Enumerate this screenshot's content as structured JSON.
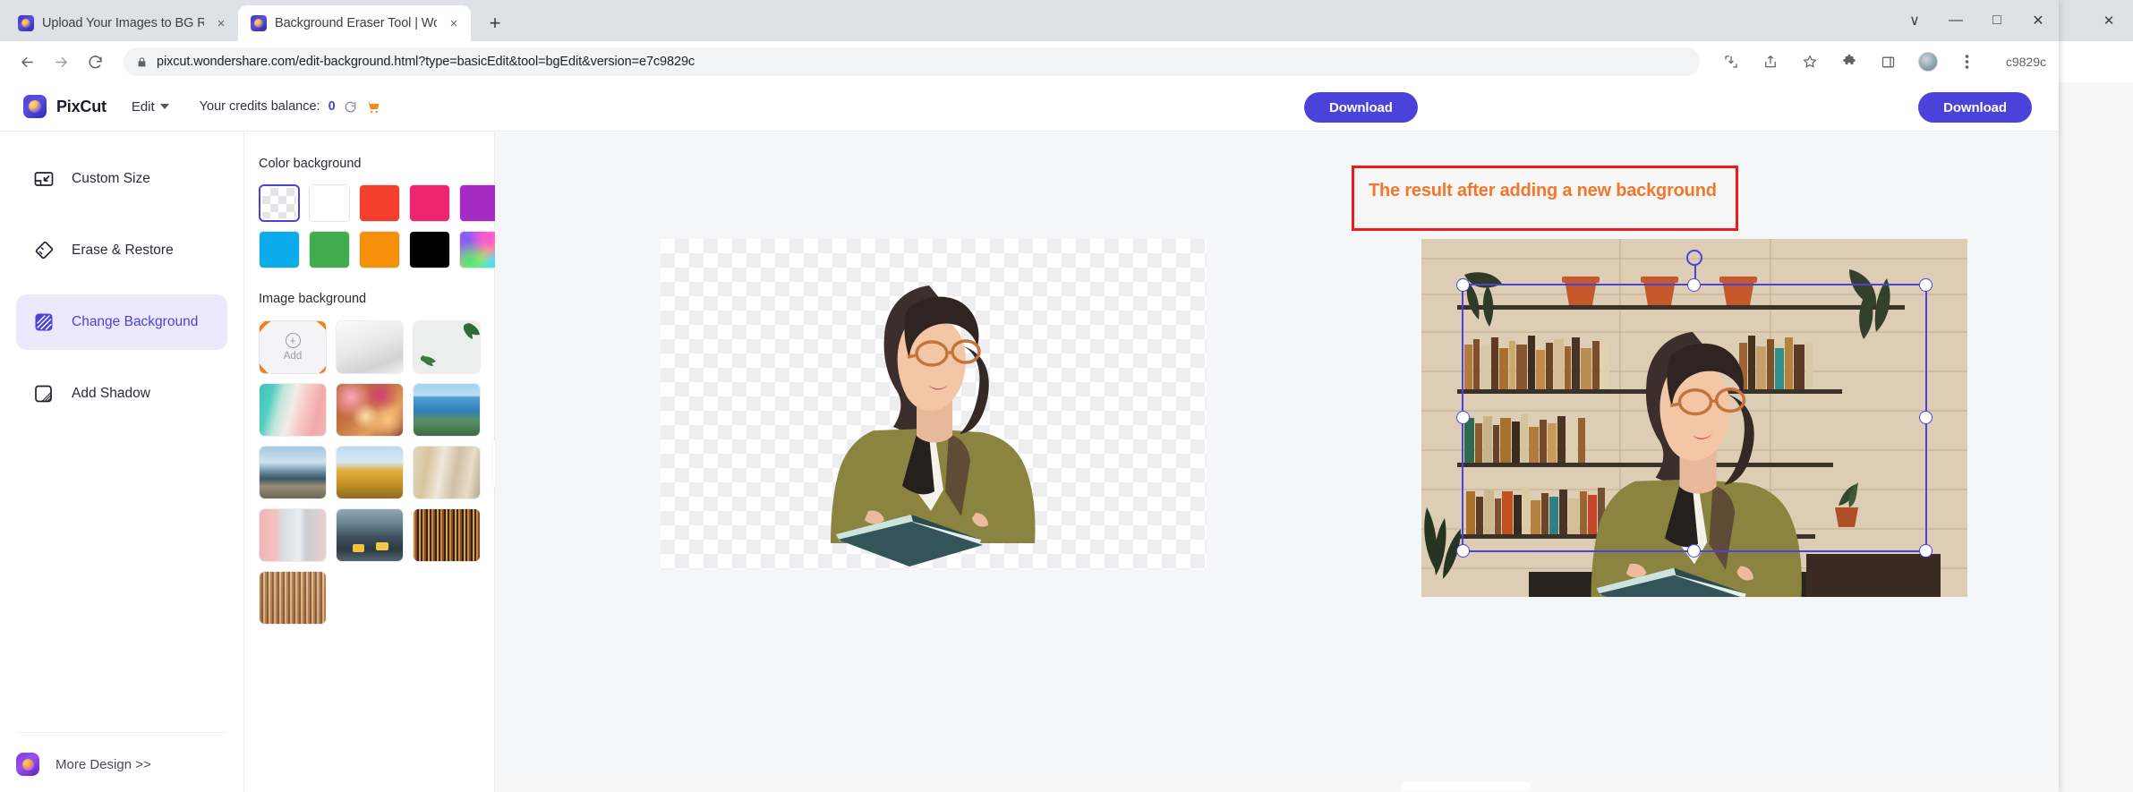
{
  "browser": {
    "tabs": [
      {
        "title": "Upload Your Images to BG Rem",
        "active": false,
        "favicon": "pixcut-favicon",
        "close": "×"
      },
      {
        "title": "Background Eraser Tool | Wonde",
        "active": true,
        "favicon": "pixcut-favicon",
        "close": "×"
      }
    ],
    "new_tab_label": "+",
    "window_controls": {
      "dropdown": "∨",
      "minimize": "—",
      "maximize": "□",
      "close": "✕"
    },
    "nav": {
      "back": "←",
      "forward": "→",
      "reload": "⟳"
    },
    "url": "pixcut.wondershare.com/edit-background.html?type=basicEdit&tool=bgEdit&version=e7c9829c",
    "lock_icon": "lock-icon",
    "omni_icons": [
      "install-icon",
      "share-icon",
      "bookmark-star-icon",
      "extensions-puzzle-icon",
      "sidebar-icon",
      "profile-avatar",
      "three-dot-menu-icon"
    ],
    "background_window_url_fragment": "c9829c"
  },
  "app": {
    "brand": "PixCut",
    "edit_menu": "Edit",
    "credits_label": "Your credits balance:",
    "credits_value": "0",
    "refresh_icon": "refresh-icon",
    "cart_icon": "cart-icon",
    "download_center": "Download",
    "download_right": "Download",
    "accent_color": "#4b43d9",
    "sidebar": {
      "items": [
        {
          "label": "Custom Size",
          "icon": "custom-size-icon",
          "active": false
        },
        {
          "label": "Erase & Restore",
          "icon": "eraser-icon",
          "active": false
        },
        {
          "label": "Change Background",
          "icon": "change-background-icon",
          "active": true
        },
        {
          "label": "Add Shadow",
          "icon": "add-shadow-icon",
          "active": false
        }
      ],
      "more_design": "More Design >>",
      "more_design_icon": "more-design-icon"
    },
    "panel": {
      "color_title": "Color background",
      "swatches": [
        {
          "name": "transparent",
          "color": "transparent",
          "selected": true
        },
        {
          "name": "white",
          "color": "#ffffff",
          "selected": false
        },
        {
          "name": "red",
          "color": "#f4402d",
          "selected": false
        },
        {
          "name": "pink",
          "color": "#f0256f",
          "selected": false
        },
        {
          "name": "purple",
          "color": "#a52bc4",
          "selected": false
        },
        {
          "name": "sky-blue",
          "color": "#0aaceb",
          "selected": false
        },
        {
          "name": "green",
          "color": "#41ab4e",
          "selected": false
        },
        {
          "name": "orange",
          "color": "#f79009",
          "selected": false
        },
        {
          "name": "black",
          "color": "#000000",
          "selected": false
        },
        {
          "name": "rainbow",
          "color": "gradient",
          "selected": false
        }
      ],
      "image_title": "Image background",
      "add_label": "Add",
      "add_plus": "+",
      "thumbnails": [
        "white-gradient",
        "leaf-shadow",
        "pastel-stripes",
        "bokeh-lights",
        "sea-coast",
        "mountain-road",
        "golden-architecture",
        "european-alley",
        "pink-doors",
        "city-taxis",
        "dark-bookshelf",
        "library-shelf"
      ],
      "collapse_icon": "chevron-left-icon"
    },
    "canvas": {
      "annotation": "The result after adding a new background",
      "annotation_border_color": "#f01a1a",
      "annotation_text_color": "#f4762a",
      "original_label": "transparent-cutout-preview",
      "result_label": "library-background-result",
      "selection_color": "#4b43d9"
    }
  }
}
